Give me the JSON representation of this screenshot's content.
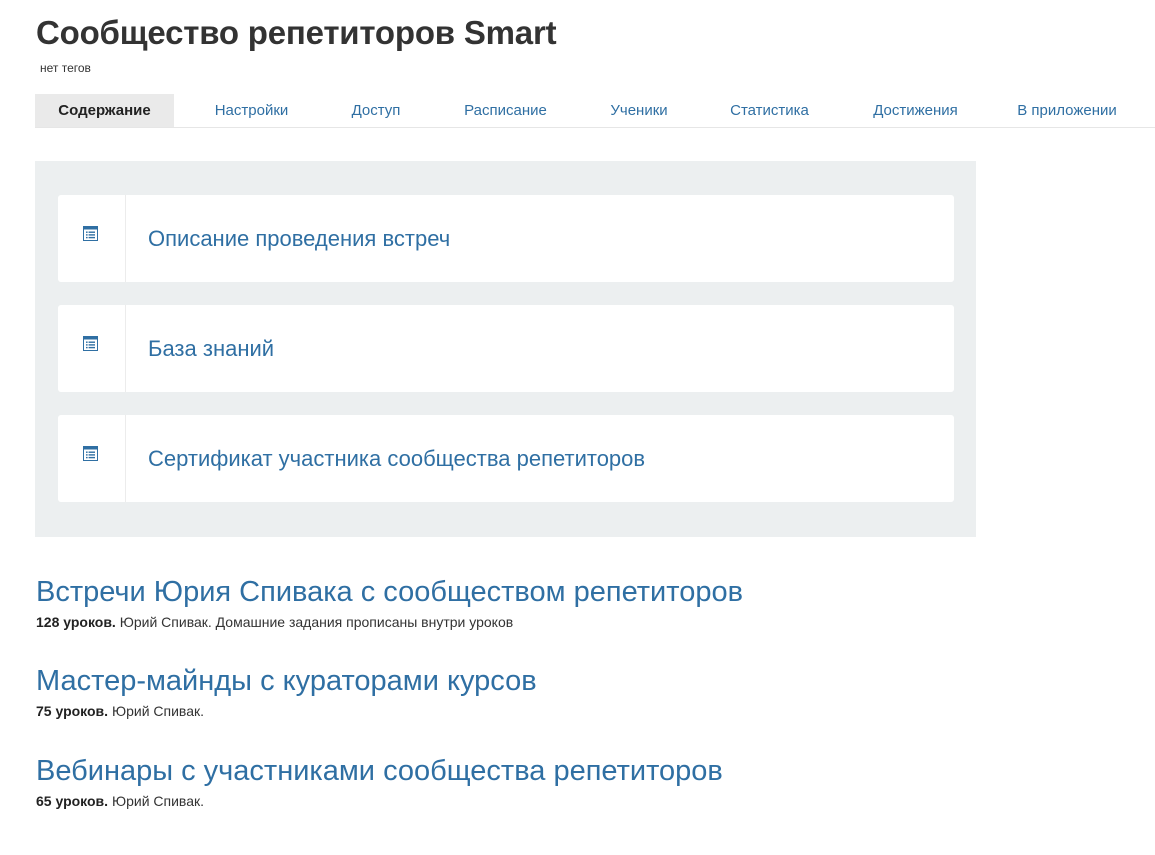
{
  "header": {
    "title": "Сообщество репетиторов Smart",
    "tags": "нет тегов"
  },
  "tabs": [
    {
      "label": "Содержание",
      "active": true
    },
    {
      "label": "Настройки"
    },
    {
      "label": "Доступ"
    },
    {
      "label": "Расписание"
    },
    {
      "label": "Ученики"
    },
    {
      "label": "Статистика"
    },
    {
      "label": "Достижения"
    },
    {
      "label": "В приложении"
    }
  ],
  "pages": [
    {
      "title": "Описание проведения встреч",
      "icon": "document-list-icon"
    },
    {
      "title": "База знаний",
      "icon": "document-list-icon"
    },
    {
      "title": "Сертификат участника сообщества репетиторов",
      "icon": "document-list-icon"
    }
  ],
  "courses": [
    {
      "title": "Встречи Юрия Спивака с сообществом репетиторов",
      "count": "128 уроков.",
      "details": "Юрий Спивак. Домашние задания прописаны внутри уроков"
    },
    {
      "title": "Мастер-майнды с кураторами курсов",
      "count": "75 уроков.",
      "details": "Юрий Спивак."
    },
    {
      "title": "Вебинары с участниками сообщества репетиторов",
      "count": "65 уроков.",
      "details": "Юрий Спивак."
    }
  ],
  "colors": {
    "link": "#2f6fa3",
    "panel_bg": "#eceff0",
    "active_tab_bg": "#eaeaea"
  }
}
